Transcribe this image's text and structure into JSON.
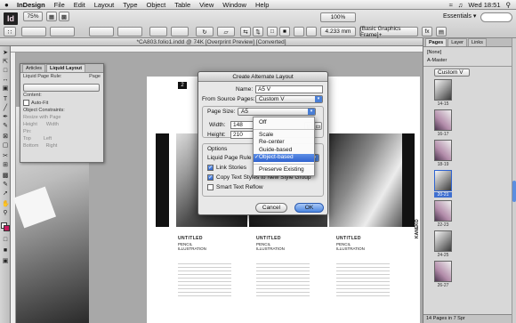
{
  "menubar": {
    "apple": "",
    "app": "InDesign",
    "items": [
      "File",
      "Edit",
      "Layout",
      "Type",
      "Object",
      "Table",
      "View",
      "Window",
      "Help"
    ],
    "clock": "Wed 18:51"
  },
  "control": {
    "logo": "Id",
    "zoom": "75%",
    "essentials": "Essentials",
    "frame_style": "[Basic Graphics Frame]+",
    "stroke_weight": "4.233 mm",
    "percent": "100%"
  },
  "document": {
    "title": "*CA803.folio1.indd @ 74K [Overprint Preview] [Converted]",
    "page_number": "2",
    "spine_text": "KANEKO",
    "captions": [
      {
        "title": "UNTITLED",
        "line1": "PENCIL",
        "line2": "ILLUSTRATION"
      },
      {
        "title": "UNTITLED",
        "line1": "PENCIL",
        "line2": "ILLUSTRATION"
      },
      {
        "title": "UNTITLED",
        "line1": "PENCIL",
        "line2": "ILLUSTRATION"
      }
    ]
  },
  "liquid_panel": {
    "tabs": [
      "Articles",
      "Liquid Layout"
    ],
    "rule_label": "Liquid Page Rule:",
    "page_label": "Page",
    "content": "Content:",
    "autofit": "Auto-Fit",
    "constraints": "Object Constraints:",
    "resize": "Resize with Page",
    "height": "Height",
    "width": "Width",
    "pin": "Pin:",
    "top": "Top",
    "left": "Left",
    "bottom": "Bottom",
    "right": "Right"
  },
  "dialog": {
    "title": "Create Alternate Layout",
    "name_label": "Name:",
    "name_value": "A5 V",
    "source_label": "From Source Pages:",
    "source_value": "Custom V",
    "page_size_label": "Page Size:",
    "page_size_value": "A5",
    "width_label": "Width:",
    "width_value": "148",
    "height_label": "Height:",
    "height_value": "210",
    "options_label": "Options",
    "liquid_rule_label": "Liquid Page Rule",
    "link_stories": "Link Stories",
    "copy_styles": "Copy Text Styles to New Style Group",
    "smart_reflow": "Smart Text Reflow",
    "cancel": "Cancel",
    "ok": "OK",
    "menu_items": [
      "Off",
      "Scale",
      "Re-center",
      "Guide-based",
      "Object-based",
      "Preserve Existing"
    ],
    "menu_selected": "Object-based",
    "checkmark": "✓"
  },
  "pages_panel": {
    "tabs": [
      "Pages",
      "Layer",
      "Links"
    ],
    "none": "[None]",
    "master": "A-Master",
    "layout": "Custom V",
    "spreads": [
      "14-15",
      "16-17",
      "18-19",
      "20-21",
      "22-23",
      "24-25",
      "26-27"
    ],
    "selected_spread": "20-21",
    "footer": "14 Pages in 7 Spr"
  }
}
